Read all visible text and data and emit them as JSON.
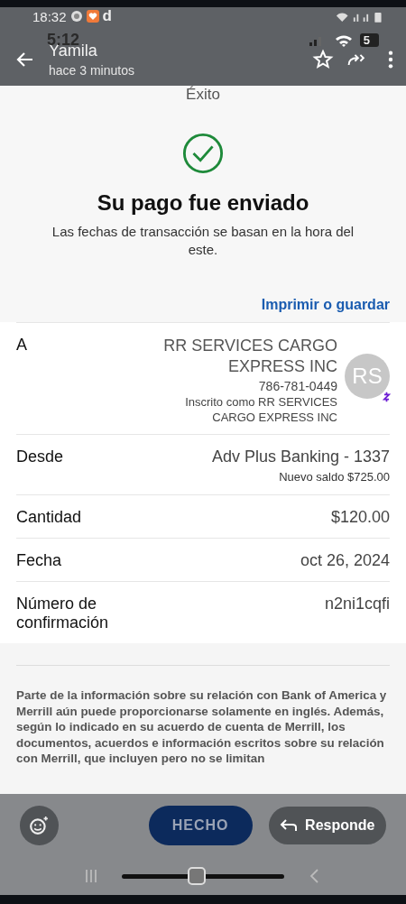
{
  "status_bar": {
    "time": "18:32",
    "app_letter": "d"
  },
  "underlying_status": {
    "time": "5:12",
    "battery": "5"
  },
  "header": {
    "title": "Yamila",
    "subtitle": "hace 3 minutos"
  },
  "screen_title": "Éxito",
  "result": {
    "heading": "Su pago fue enviado",
    "note": "Las fechas de transacción se basan en la hora del este.",
    "link": "Imprimir o guardar"
  },
  "recipient": {
    "label": "A",
    "name": "RR SERVICES CARGO EXPRESS INC",
    "phone": "786-781-0449",
    "enrolled": "Inscrito como RR SERVICES CARGO EXPRESS INC",
    "avatar": "RS"
  },
  "details": [
    {
      "label": "Desde",
      "value": "Adv Plus Banking - 1337",
      "sub": "Nuevo saldo $725.00"
    },
    {
      "label": "Cantidad",
      "value": "$120.00"
    },
    {
      "label": "Fecha",
      "value": "oct 26, 2024"
    },
    {
      "label": "Número de confirmación",
      "value": "n2ni1cqfi"
    }
  ],
  "disclaimer": "Parte de la información sobre su relación con Bank of America y Merrill aún puede proporcionarse solamente en inglés. Además, según lo indicado en su acuerdo de cuenta de Merrill, los documentos, acuerdos e información escritos sobre su relación con Merrill, que incluyen pero no se limitan",
  "actions": {
    "done": "HECHO",
    "reply": "Responde"
  }
}
